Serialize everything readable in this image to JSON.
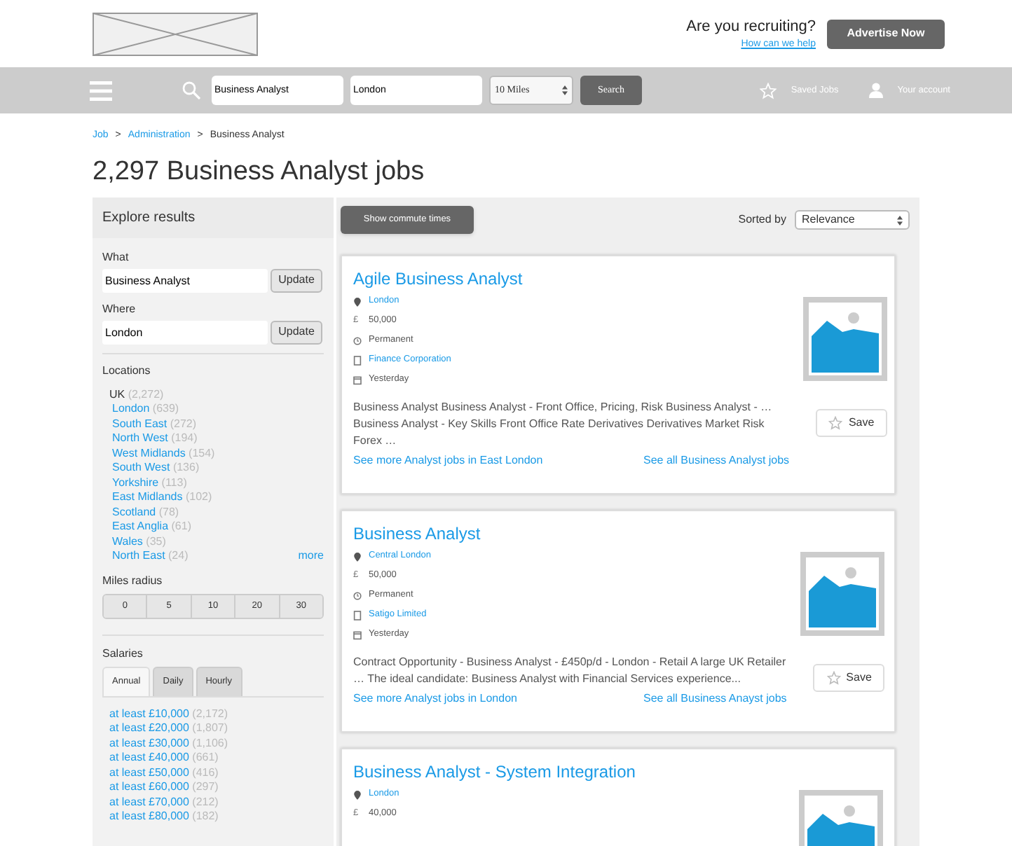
{
  "header": {
    "recruit_question": "Are you recruiting?",
    "recruit_link": "How can we help",
    "advertise_button": "Advertise Now"
  },
  "navbar": {
    "what": "Business Analyst",
    "where": "London",
    "distance": "10 Miles",
    "search_button": "Search",
    "saved_jobs": "Saved Jobs",
    "account": "Your account"
  },
  "breadcrumb_separator": ">",
  "breadcrumb": [
    {
      "label": "Job",
      "link": true
    },
    {
      "label": "Administration",
      "link": true
    },
    {
      "label": "Business Analyst",
      "link": false
    }
  ],
  "page_title": "2,297 Business Analyst jobs",
  "sidebar": {
    "title": "Explore results",
    "what": {
      "label": "What",
      "value": "Business Analyst",
      "button": "Update"
    },
    "where": {
      "label": "Where",
      "value": "London",
      "button": "Update"
    },
    "locations": {
      "label": "Locations",
      "root": {
        "name": "UK",
        "count": "(2,272)"
      },
      "items": [
        {
          "name": "London",
          "count": "(639)"
        },
        {
          "name": "South East",
          "count": "(272)"
        },
        {
          "name": "North West",
          "count": "(194)"
        },
        {
          "name": "West Midlands",
          "count": "(154)"
        },
        {
          "name": "South West",
          "count": "(136)"
        },
        {
          "name": "Yorkshire",
          "count": "(113)"
        },
        {
          "name": "East Midlands",
          "count": "(102)"
        },
        {
          "name": "Scotland",
          "count": "(78)"
        },
        {
          "name": "East Anglia",
          "count": "(61)"
        },
        {
          "name": "Wales",
          "count": "(35)"
        },
        {
          "name": "North East",
          "count": "(24)"
        }
      ],
      "more": "more"
    },
    "miles_radius": {
      "label": "Miles radius",
      "options": [
        "0",
        "5",
        "10",
        "20",
        "30"
      ]
    },
    "salaries": {
      "label": "Salaries",
      "tabs": [
        {
          "label": "Annual",
          "selected": true
        },
        {
          "label": "Daily",
          "selected": false
        },
        {
          "label": "Hourly",
          "selected": false
        }
      ],
      "items": [
        {
          "label": "at least £10,000",
          "count": "(2,172)"
        },
        {
          "label": "at least £20,000",
          "count": "(1,807)"
        },
        {
          "label": "at least £30,000",
          "count": "(1,106)"
        },
        {
          "label": "at least £40,000",
          "count": "(661)"
        },
        {
          "label": "at least £50,000",
          "count": "(416)"
        },
        {
          "label": "at least £60,000",
          "count": "(297)"
        },
        {
          "label": "at least £70,000",
          "count": "(212)"
        },
        {
          "label": "at least £80,000",
          "count": "(182)"
        }
      ]
    }
  },
  "results": {
    "commute_button": "Show commute times",
    "sort_label": "Sorted by",
    "sort_value": "Relevance",
    "jobs": [
      {
        "title": "Agile Business Analyst",
        "meta": [
          {
            "kind": "location",
            "text": "London"
          },
          {
            "kind": "salary",
            "symbol": "£",
            "text": "50,000"
          },
          {
            "kind": "contract",
            "text": "Permanent"
          },
          {
            "kind": "company",
            "text": "Finance Corporation"
          },
          {
            "kind": "date",
            "text": "Yesterday"
          }
        ],
        "description": "Business Analyst Business Analyst - Front Office, Pricing, Risk Business Analyst - … Business Analyst - Key Skills Front Office Rate Derivatives Derivatives Market Risk Forex …",
        "save": "Save",
        "links": [
          "See more Analyst jobs in East London",
          "See all Business Analyst jobs"
        ]
      },
      {
        "title": "Business Analyst",
        "meta": [
          {
            "kind": "location",
            "text": "Central London"
          },
          {
            "kind": "salary",
            "symbol": "£",
            "text": "50,000"
          },
          {
            "kind": "contract",
            "text": "Permanent"
          },
          {
            "kind": "company",
            "text": "Satigo Limited"
          },
          {
            "kind": "date",
            "text": "Yesterday"
          }
        ],
        "description": "Contract Opportunity - Business Analyst - £450p/d - London - Retail A large UK Retailer … The ideal candidate: Business Analyst with Financial Services experience...",
        "save": "Save",
        "links": [
          "See more Analyst jobs in London",
          "See all Business Anayst jobs"
        ]
      },
      {
        "title": "Business Analyst - System Integration",
        "meta": [
          {
            "kind": "location",
            "text": "London"
          },
          {
            "kind": "salary",
            "symbol": "£",
            "text": "40,000"
          }
        ]
      }
    ]
  }
}
